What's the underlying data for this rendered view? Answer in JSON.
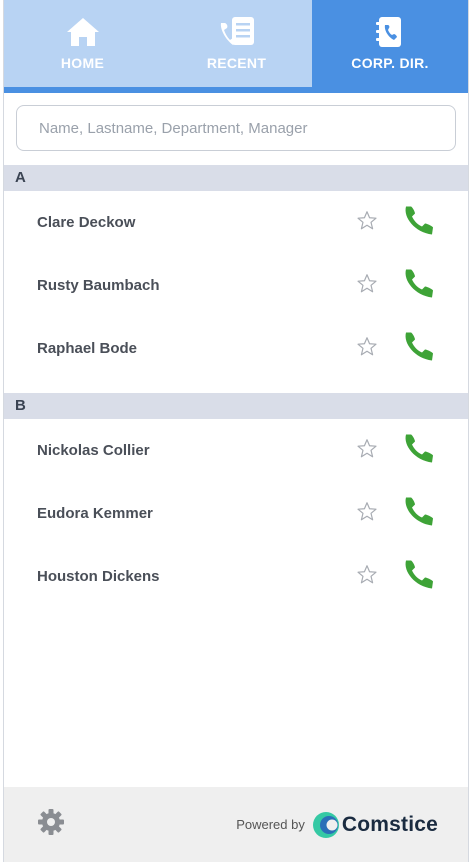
{
  "tabs": [
    {
      "label": "HOME",
      "icon": "home-icon"
    },
    {
      "label": "RECENT",
      "icon": "recent-calls-icon"
    },
    {
      "label": "CORP. DIR.",
      "icon": "directory-icon"
    }
  ],
  "search": {
    "placeholder": "Name, Lastname, Department, Manager",
    "value": ""
  },
  "sections": [
    {
      "letter": "A",
      "contacts": [
        {
          "name": "Clare Deckow"
        },
        {
          "name": "Rusty Baumbach"
        },
        {
          "name": "Raphael Bode"
        }
      ]
    },
    {
      "letter": "B",
      "contacts": [
        {
          "name": "Nickolas Collier"
        },
        {
          "name": "Eudora Kemmer"
        },
        {
          "name": "Houston Dickens"
        }
      ]
    }
  ],
  "footer": {
    "powered_by": "Powered by",
    "brand": "Comstice"
  },
  "colors": {
    "accent": "#4a90e2",
    "tab_light": "#b8d3f3",
    "call_green": "#3ea337",
    "section_bg": "#d9dde8"
  }
}
